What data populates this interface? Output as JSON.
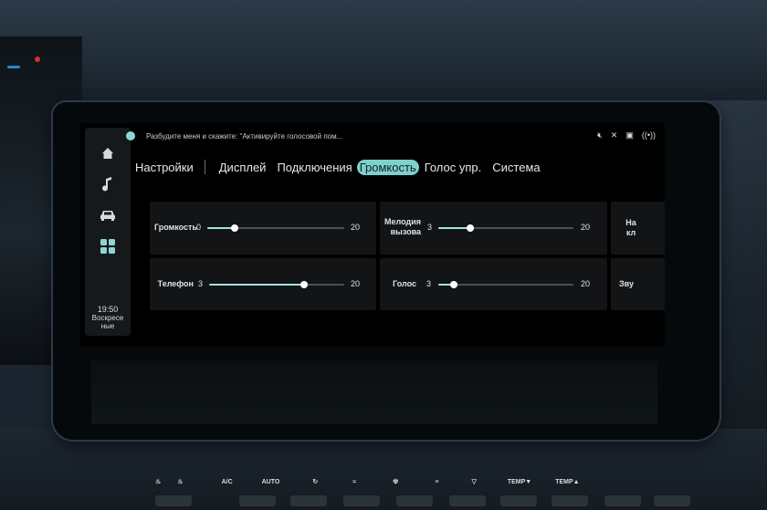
{
  "screen": {
    "voice_hint": "Разбудите меня и скажите: \"Активируйте голосовой пом...",
    "status_icons": [
      "mute-icon",
      "bluetooth-off-icon",
      "camera-icon",
      "signal-icon"
    ],
    "page_title": "Настройки",
    "tabs": [
      {
        "label": "Дисплей",
        "active": false
      },
      {
        "label": "Подключения",
        "active": false
      },
      {
        "label": "Громкость",
        "active": true
      },
      {
        "label": "Голос упр.",
        "active": false
      },
      {
        "label": "Система",
        "active": false
      }
    ],
    "side_nav": [
      "home-icon",
      "music-icon",
      "car-icon",
      "apps-icon"
    ],
    "clock": {
      "time": "19:50",
      "day": "Воскресе ные"
    },
    "sliders": [
      {
        "label": "Громкость",
        "min": "0",
        "max": "20",
        "value": 4
      },
      {
        "label": "Мелодия вызова",
        "min": "3",
        "max": "20",
        "value": 7
      },
      {
        "label": "Телефон",
        "min": "3",
        "max": "20",
        "value": 15
      },
      {
        "label": "Голос",
        "min": "3",
        "max": "20",
        "value": 5
      }
    ],
    "cut_panels": [
      {
        "label": "На кл"
      },
      {
        "label": "Зву"
      }
    ],
    "accent_color": "#7fd0cb"
  },
  "climate": {
    "labels": [
      "A/C",
      "AUTO",
      "TEMP▼",
      "TEMP▲"
    ]
  }
}
